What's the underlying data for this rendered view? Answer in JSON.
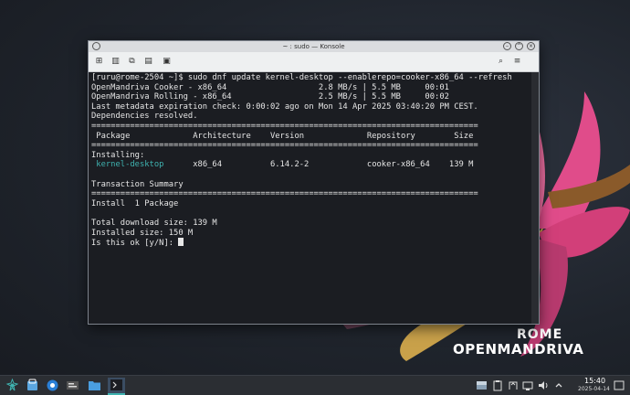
{
  "window": {
    "title": "~ : sudo — Konsole"
  },
  "terminal": {
    "lines": [
      "[ruru@rome-2504 ~]$ sudo dnf update kernel-desktop --enablerepo=cooker-x86_64 --refresh",
      "OpenMandriva Cooker - x86_64                   2.8 MB/s | 5.5 MB     00:01",
      "OpenMandriva Rolling - x86_64                  2.5 MB/s | 5.5 MB     00:02",
      "Last metadata expiration check: 0:00:02 ago on Mon 14 Apr 2025 03:40:20 PM CEST.",
      "Dependencies resolved.",
      "================================================================================",
      " Package             Architecture    Version             Repository        Size",
      "================================================================================",
      "Installing:",
      "                     x86_64          6.14.2-2            cooker-x86_64    139 M",
      "",
      "Transaction Summary",
      "================================================================================",
      "Install  1 Package",
      "",
      "Total download size: 139 M",
      "Installed size: 150 M",
      "Is this ok [y/N]: "
    ],
    "package_name": " kernel-desktop"
  },
  "wallpaper": {
    "brand_top": "ROME",
    "brand_bottom": "OPENMANDRIVA"
  },
  "taskbar": {
    "time": "15:40",
    "date": "2025-04-14"
  },
  "colors": {
    "accent": "#3fb3b0",
    "flower": "#d9467f"
  }
}
